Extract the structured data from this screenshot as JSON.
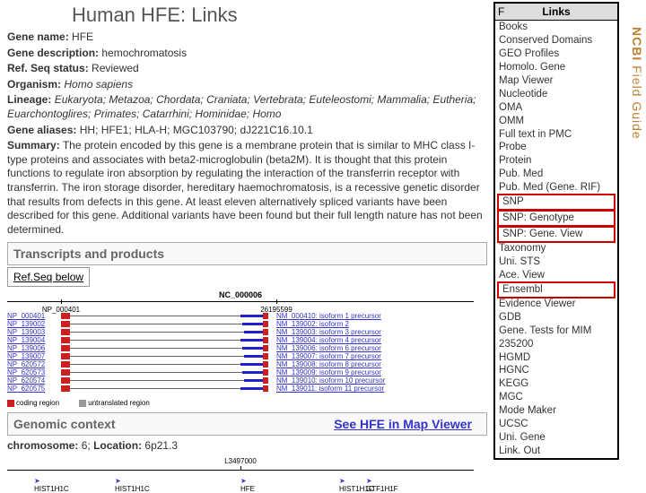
{
  "slide_title": "Human HFE: Links",
  "fields": {
    "gene_name_label": "Gene name:",
    "gene_name_value": "HFE",
    "gene_desc_label": "Gene description:",
    "gene_desc_value": "hemochromatosis",
    "refseq_label": "Ref. Seq status:",
    "refseq_value": "Reviewed",
    "organism_label": "Organism:",
    "organism_value": "Homo sapiens",
    "lineage_label": "Lineage:",
    "lineage_value": "Eukaryota; Metazoa; Chordata; Craniata; Vertebrata; Euteleostomi; Mammalia; Eutheria; Euarchontoglires; Primates; Catarrhini; Hominidae; Homo",
    "aliases_label": "Gene aliases:",
    "aliases_value": "HH; HFE1; HLA-H; MGC103790; dJ221C16.10.1",
    "summary_label": "Summary:",
    "summary_value": "The protein encoded by this gene is a membrane protein that is similar to MHC class I-type proteins and associates with beta2-microglobulin (beta2M). It is thought that this protein functions to regulate iron absorption by regulating the interaction of the transferrin receptor with transferrin. The iron storage disorder, hereditary haemochromatosis, is a recessive genetic disorder that results from defects in this gene. At least eleven alternatively spliced variants have been described for this gene. Additional variants have been found but their full length nature has not been determined."
  },
  "transcripts_header": "Transcripts and products",
  "refseq_below": "Ref.Seq below",
  "chrom_label": "NC_000006",
  "tick1": "NP_000401",
  "tick2": "26195599",
  "left_ids": [
    "NP_000401",
    "NP_139002",
    "NP_139003",
    "NP_139004",
    "NP_139006",
    "NP_139007",
    "NP_620572",
    "NP_620573",
    "NP_620574",
    "NP_620575"
  ],
  "right_ids": [
    "NM_000410: isoform 1 precursor",
    "NM_139002: isoform 2",
    "NM_139003: isoform 3 precursor",
    "NM_139004: isoform 4 precursor",
    "NM_139006: isoform 6 precursor",
    "NM_139007: isoform 7 precursor",
    "NM_139008: isoform 8 precursor",
    "NM_139009: isoform 9 precursor",
    "NM_139010: isoform 10 precursor",
    "NM_139011: isoform 11 precursor"
  ],
  "legend_coding": "coding region",
  "legend_untranslated": "untranslated region",
  "genomic_header": "Genomic context",
  "mapviewer_link": "See HFE in Map Viewer",
  "chrom_loc_label_chrom": "chromosome:",
  "chrom_loc_value_chrom": "6;",
  "chrom_loc_label_loc": "Location:",
  "chrom_loc_value_loc": "6p21.3",
  "genes": [
    "HIST1H1C",
    "HIST1H1C",
    "HFE",
    "HIST1H1C",
    "GTF1H1F"
  ],
  "gctick": "L3497000",
  "links_panel": {
    "header": "Links",
    "header_f": "F",
    "items": [
      {
        "label": "Books",
        "box": false
      },
      {
        "label": "Conserved Domains",
        "box": false
      },
      {
        "label": "GEO Profiles",
        "box": false
      },
      {
        "label": "Homolo. Gene",
        "box": false
      },
      {
        "label": "Map Viewer",
        "box": false
      },
      {
        "label": "Nucleotide",
        "box": false
      },
      {
        "label": "OMA",
        "box": false
      },
      {
        "label": "OMM",
        "box": false
      },
      {
        "label": "Full text in PMC",
        "box": false
      },
      {
        "label": "Probe",
        "box": false
      },
      {
        "label": "Protein",
        "box": false
      },
      {
        "label": "Pub. Med",
        "box": false
      },
      {
        "label": "Pub. Med (Gene. RIF)",
        "box": false
      },
      {
        "label": "SNP",
        "box": true
      },
      {
        "label": "SNP: Genotype",
        "box": true
      },
      {
        "label": "SNP: Gene. View",
        "box": true
      },
      {
        "label": "Taxonomy",
        "box": false
      },
      {
        "label": "Uni. STS",
        "box": false
      },
      {
        "label": "Ace. View",
        "box": false
      },
      {
        "label": "Ensembl",
        "box": true
      },
      {
        "label": "Evidence Viewer",
        "box": false
      },
      {
        "label": "GDB",
        "box": false
      },
      {
        "label": "Gene. Tests for MIM",
        "box": false
      },
      {
        "label": "235200",
        "box": false
      },
      {
        "label": "HGMD",
        "box": false
      },
      {
        "label": "HGNC",
        "box": false
      },
      {
        "label": "KEGG",
        "box": false
      },
      {
        "label": "MGC",
        "box": false
      },
      {
        "label": "Mode Maker",
        "box": false
      },
      {
        "label": "UCSC",
        "box": false
      },
      {
        "label": "Uni. Gene",
        "box": false
      },
      {
        "label": "Link. Out",
        "box": false
      }
    ]
  },
  "vertical_label_bold": "NCBI",
  "vertical_label_rest": " Field Guide"
}
